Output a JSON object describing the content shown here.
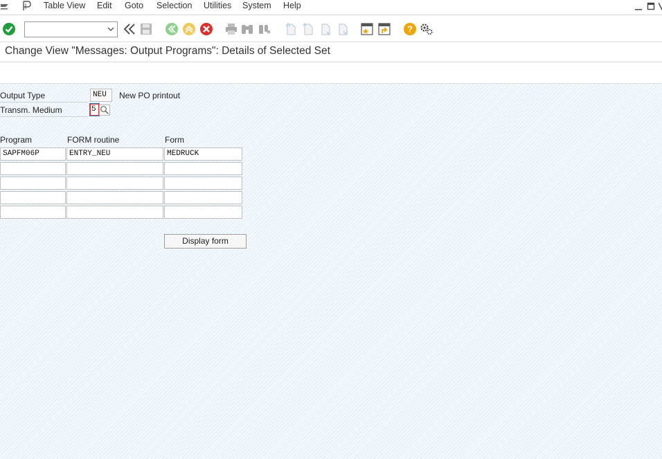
{
  "menubar": {
    "items": [
      "Table View",
      "Edit",
      "Goto",
      "Selection",
      "Utilities",
      "System",
      "Help"
    ]
  },
  "toolbar": {
    "command_value": "",
    "icons": [
      "enter-icon",
      "back-double-icon",
      "save-icon",
      "back-icon",
      "exit-icon",
      "cancel-icon",
      "print-icon",
      "find-icon",
      "find-next-icon",
      "first-page-icon",
      "previous-page-icon",
      "next-page-icon",
      "last-page-icon",
      "create-session-icon",
      "shortcut-icon",
      "help-icon",
      "customize-layout-icon"
    ]
  },
  "title": "Change View \"Messages: Output Programs\": Details of Selected Set",
  "form": {
    "output_type_label": "Output Type",
    "output_type_value": "NEU",
    "output_type_desc": "New PO printout",
    "transm_medium_label": "Transm. Medium",
    "transm_medium_value": "5"
  },
  "table": {
    "headers": [
      "Program",
      "FORM routine",
      "Form"
    ],
    "rows": [
      [
        "SAPFM06P",
        "ENTRY_NEU",
        "MEDRUCK"
      ],
      [
        "",
        "",
        ""
      ],
      [
        "",
        "",
        ""
      ],
      [
        "",
        "",
        ""
      ],
      [
        "",
        "",
        ""
      ]
    ]
  },
  "buttons": {
    "display_form": "Display form"
  },
  "colors": {
    "ok_green": "#1e9e3a",
    "cancel_red": "#d9302c",
    "help_orange": "#f0a500",
    "focus_red": "#d23c3c"
  }
}
